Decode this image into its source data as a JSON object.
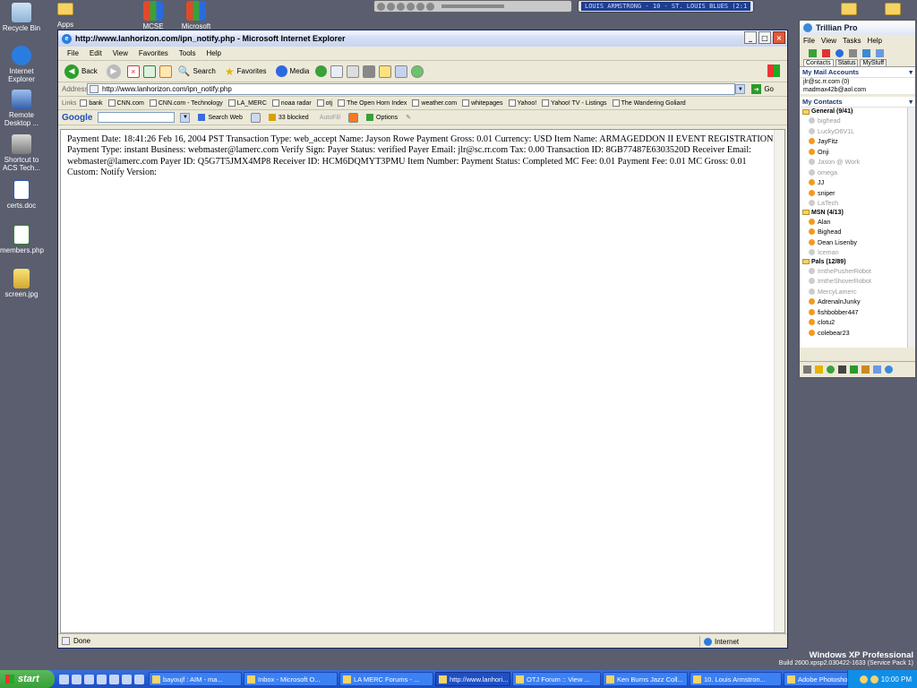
{
  "desktop": {
    "icons": [
      {
        "label": "Recycle Bin"
      },
      {
        "label": "Internet Explorer"
      },
      {
        "label": "Remote Desktop ..."
      },
      {
        "label": "Shortcut to ACS Tech..."
      },
      {
        "label": "certs.doc"
      },
      {
        "label": "members.php"
      },
      {
        "label": "screen.jpg"
      }
    ],
    "top_icons": [
      {
        "label": "Apps"
      },
      {
        "label": "MCSE Training"
      },
      {
        "label": "Microsoft"
      }
    ]
  },
  "media_player": {
    "lcd_text": "LOUIS ARMSTRONG - 10 - ST. LOUIS BLUES (2:1"
  },
  "ie": {
    "title": "http://www.lanhorizon.com/ipn_notify.php - Microsoft Internet Explorer",
    "menu": [
      "File",
      "Edit",
      "View",
      "Favorites",
      "Tools",
      "Help"
    ],
    "toolbar": {
      "back": "Back",
      "search": "Search",
      "favorites": "Favorites",
      "media": "Media"
    },
    "address_label": "Address",
    "address_value": "http://www.lanhorizon.com/ipn_notify.php",
    "go": "Go",
    "links_label": "Links",
    "links": [
      "bank",
      "CNN.com",
      "CNN.com - Technology",
      "LA_MERC",
      "noaa radar",
      "otj",
      "The Open Horn Index",
      "weather.com",
      "whitepages",
      "Yahoo!",
      "Yahoo! TV - Listings",
      "The Wandering Goliard"
    ],
    "google": {
      "logo": "Google",
      "search_web": "Search Web",
      "blocked": "33 blocked",
      "autofill": "AutoFill",
      "options": "Options"
    },
    "content_text": "Payment Date: 18:41:26 Feb 16, 2004 PST Transaction Type: web_accept Name: Jayson Rowe Payment Gross: 0.01 Currency: USD Item Name: ARMAGEDDON II EVENT REGISTRATION Payment Type: instant Business: webmaster@lamerc.com Verify Sign: Payer Status: verified Payer Email: jlr@sc.rr.com Tax: 0.00 Transaction ID: 8GB77487E6303520D Receiver Email: webmaster@lamerc.com Payer ID: Q5G7T5JMX4MP8 Receiver ID: HCM6DQMYT3PMU Item Number: Payment Status: Completed MC Fee: 0.01 Payment Fee: 0.01 MC Gross: 0.01 Custom: Notify Version:",
    "status": "Done",
    "zone": "Internet"
  },
  "trillian": {
    "title": "Trillian Pro",
    "menu": [
      "File",
      "View",
      "Tasks",
      "Help"
    ],
    "tabs": [
      "Contacts",
      "Status",
      "MyStuff"
    ],
    "mail_header": "My Mail Accounts",
    "mail": [
      "jlr@sc.rr.com (0)",
      "madmax42b@aol.com"
    ],
    "contacts_header": "My Contacts",
    "groups": [
      {
        "name": "General (9/41)",
        "contacts": [
          {
            "name": "bighead",
            "online": false
          },
          {
            "name": "LuckyO6V1L",
            "online": false
          },
          {
            "name": "JayFitz",
            "online": true
          },
          {
            "name": "Onji",
            "online": true
          },
          {
            "name": "Jason @ Work",
            "online": false
          },
          {
            "name": "omega",
            "online": false
          },
          {
            "name": "JJ",
            "online": true
          },
          {
            "name": "sniper",
            "online": true
          },
          {
            "name": "LaTech",
            "online": false
          }
        ]
      },
      {
        "name": "MSN (4/13)",
        "contacts": [
          {
            "name": "Alan",
            "online": true
          },
          {
            "name": "Bighead",
            "online": true
          },
          {
            "name": "Dean Lisenby",
            "online": true
          },
          {
            "name": "Iceman",
            "online": false
          }
        ]
      },
      {
        "name": "Pals (12/89)",
        "contacts": [
          {
            "name": "ImthePusherRobot",
            "online": false
          },
          {
            "name": "ImtheShoverRobot",
            "online": false
          },
          {
            "name": "MercyLamerc",
            "online": false
          },
          {
            "name": "AdrenalnJunky",
            "online": true
          },
          {
            "name": "fishbobber447",
            "online": true
          },
          {
            "name": "clotu2",
            "online": true
          },
          {
            "name": "colebear23",
            "online": true
          }
        ]
      }
    ]
  },
  "watermark": {
    "os": "Windows XP Professional",
    "build": "Build 2600.xpsp2.030422-1633 (Service Pack 1)"
  },
  "taskbar": {
    "start": "start",
    "tasks": [
      {
        "label": "bayoujf : AIM - ma...",
        "active": false
      },
      {
        "label": "Inbox - Microsoft O...",
        "active": false
      },
      {
        "label": "LA MERC Forums - ...",
        "active": false
      },
      {
        "label": "http://www.lanhori...",
        "active": true
      },
      {
        "label": "OTJ Forum :: View ...",
        "active": false
      },
      {
        "label": "Ken Burns Jazz Coll...",
        "active": false
      },
      {
        "label": "10. Louis Armstron...",
        "active": false
      },
      {
        "label": "Adobe Photoshop",
        "active": false
      }
    ],
    "clock": "10:00 PM"
  }
}
